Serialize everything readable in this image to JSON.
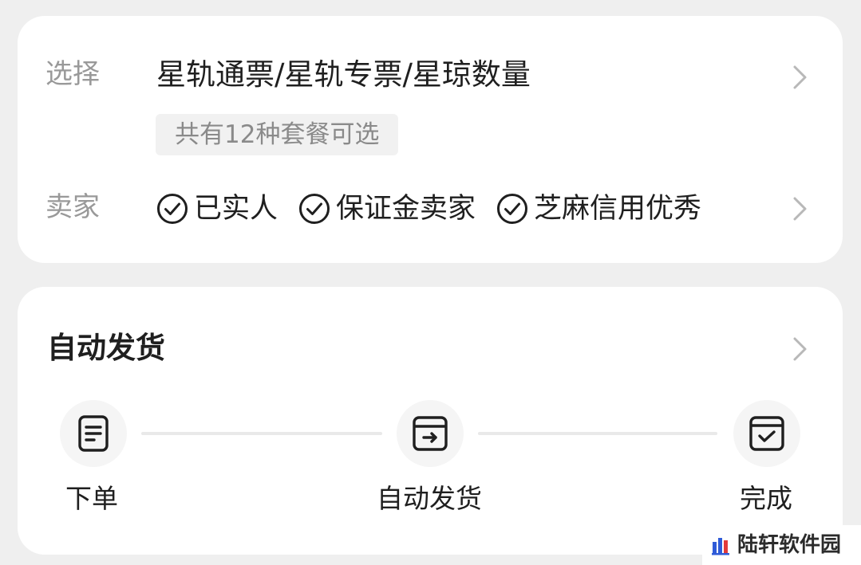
{
  "selection_card": {
    "select_label": "选择",
    "select_value": "星轨通票/星轨专票/星琼数量",
    "package_tag": "共有12种套餐可选",
    "seller_label": "卖家",
    "seller_badges": [
      {
        "label": "已实人",
        "icon": "check-circle-icon"
      },
      {
        "label": "保证金卖家",
        "icon": "check-circle-icon"
      },
      {
        "label": "芝麻信用优秀",
        "icon": "check-circle-icon"
      }
    ]
  },
  "delivery_card": {
    "title": "自动发货",
    "steps": [
      {
        "label": "下单",
        "icon": "order-document-icon"
      },
      {
        "label": "自动发货",
        "icon": "auto-ship-box-icon"
      },
      {
        "label": "完成",
        "icon": "completed-box-icon"
      }
    ]
  },
  "watermark": {
    "text": "陆轩软件园"
  },
  "colors": {
    "page_background": "#efefef",
    "card_background": "#ffffff",
    "muted_text": "#999999",
    "primary_text": "#1f1f1f",
    "tag_background": "#f1f1f1",
    "step_circle": "#f5f5f5",
    "step_line": "#e9e9e9",
    "watermark_blue": "#2f5bd8",
    "watermark_red": "#e23b3b"
  }
}
